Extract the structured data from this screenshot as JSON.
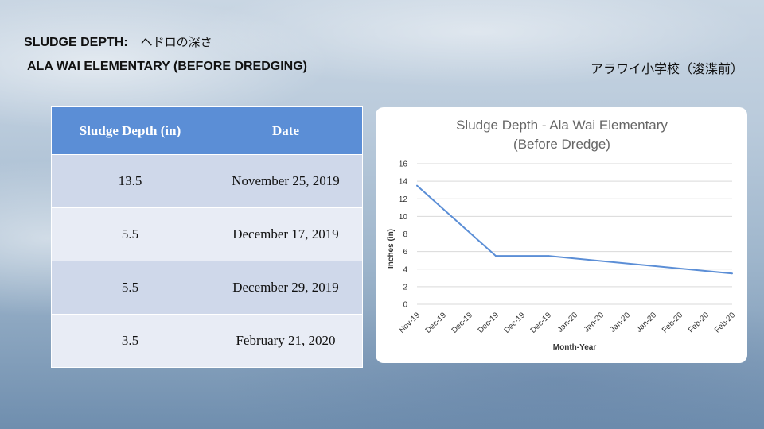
{
  "header": {
    "line1_en": "SLUDGE DEPTH:",
    "line1_jp": "ヘドロの深さ",
    "line2": "ALA WAI ELEMENTARY (BEFORE DREDGING)",
    "line2_jp": "アラワイ小学校（浚渫前）"
  },
  "table": {
    "headers": [
      "Sludge Depth (in)",
      "Date"
    ],
    "rows": [
      [
        "13.5",
        "November 25, 2019"
      ],
      [
        "5.5",
        "December 17, 2019"
      ],
      [
        "5.5",
        "December 29, 2019"
      ],
      [
        "3.5",
        "February 21, 2020"
      ]
    ]
  },
  "colors": {
    "header_blue": "#5b8ed6",
    "row_dark": "#cfd8ea",
    "row_light": "#e8ecf5",
    "line": "#5b8ed6"
  },
  "chart_data": {
    "type": "line",
    "title": "Sludge Depth - Ala Wai Elementary",
    "subtitle": "(Before Dredge)",
    "xlabel": "Month-Year",
    "ylabel": "Inches (in)",
    "ylim": [
      0,
      16
    ],
    "yticks": [
      0,
      2,
      4,
      6,
      8,
      10,
      12,
      14,
      16
    ],
    "categories": [
      "Nov-19",
      "Dec-19",
      "Dec-19",
      "Dec-19",
      "Dec-19",
      "Dec-19",
      "Jan-20",
      "Jan-20",
      "Jan-20",
      "Jan-20",
      "Feb-20",
      "Feb-20",
      "Feb-20"
    ],
    "points": [
      {
        "x_index": 0,
        "y": 13.5
      },
      {
        "x_index": 3,
        "y": 5.5
      },
      {
        "x_index": 5,
        "y": 5.5
      },
      {
        "x_index": 12,
        "y": 3.5
      }
    ],
    "grid": true,
    "legend": "none"
  }
}
